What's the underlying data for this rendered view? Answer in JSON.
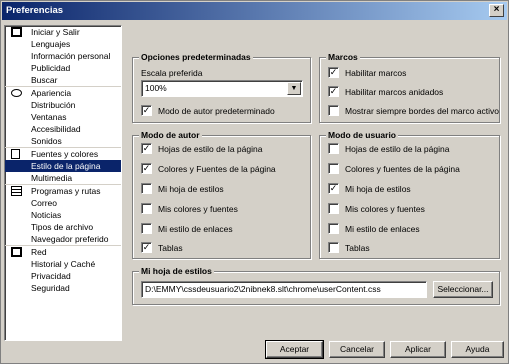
{
  "window": {
    "title": "Preferencias",
    "close_glyph": "×"
  },
  "nav": {
    "groups": [
      {
        "icon": "house-icon",
        "items": [
          "Iniciar y Salir",
          "Lenguajes",
          "Información personal",
          "Publicidad",
          "Buscar"
        ]
      },
      {
        "icon": "eye-icon",
        "items": [
          "Apariencia",
          "Distribución",
          "Ventanas",
          "Accesibilidad",
          "Sonidos"
        ]
      },
      {
        "icon": "document-icon",
        "items": [
          "Fuentes y colores",
          "Estilo de la página",
          "Multimedia"
        ],
        "selected": 1
      },
      {
        "icon": "calendar-icon",
        "items": [
          "Programas y rutas",
          "Correo",
          "Noticias",
          "Tipos de archivo",
          "Navegador preferido"
        ]
      },
      {
        "icon": "network-icon",
        "items": [
          "Red",
          "Historial y Caché",
          "Privacidad",
          "Seguridad"
        ]
      }
    ]
  },
  "defaults": {
    "title": "Opciones predeterminadas",
    "scale_label": "Escala preferida",
    "scale_value": "100%",
    "author_mode_label": "Modo de autor predeterminado",
    "author_mode_checked": "✓"
  },
  "frames": {
    "title": "Marcos",
    "options": [
      {
        "label": "Habilitar marcos",
        "check": "✓"
      },
      {
        "label": "Habilitar marcos anidados",
        "check": "✓"
      },
      {
        "label": "Mostrar siempre bordes del marco activo",
        "check": ""
      }
    ]
  },
  "author_mode": {
    "title": "Modo de autor",
    "options": [
      {
        "label": "Hojas de estilo de la página",
        "check": "✓"
      },
      {
        "label": "Colores y Fuentes de la página",
        "check": "✓"
      },
      {
        "label": "Mi hoja de estilos",
        "check": ""
      },
      {
        "label": "Mis colores y fuentes",
        "check": ""
      },
      {
        "label": "Mi estilo de enlaces",
        "check": ""
      },
      {
        "label": "Tablas",
        "check": "✓"
      }
    ]
  },
  "user_mode": {
    "title": "Modo de usuario",
    "options": [
      {
        "label": "Hojas de estilo de la página",
        "check": ""
      },
      {
        "label": "Colores y fuentes de la página",
        "check": ""
      },
      {
        "label": "Mi hoja de estilos",
        "check": "✓"
      },
      {
        "label": "Mis colores y fuentes",
        "check": ""
      },
      {
        "label": "Mi estilo de enlaces",
        "check": ""
      },
      {
        "label": "Tablas",
        "check": ""
      }
    ]
  },
  "stylesheet": {
    "title": "Mi hoja de estilos",
    "path": "D:\\EMMY\\cssdeusuario2\\2nibnek8.slt\\chrome\\userContent.css",
    "select_button": "Seleccionar..."
  },
  "buttons": {
    "accept": "Aceptar",
    "cancel": "Cancelar",
    "apply": "Aplicar",
    "help": "Ayuda"
  }
}
